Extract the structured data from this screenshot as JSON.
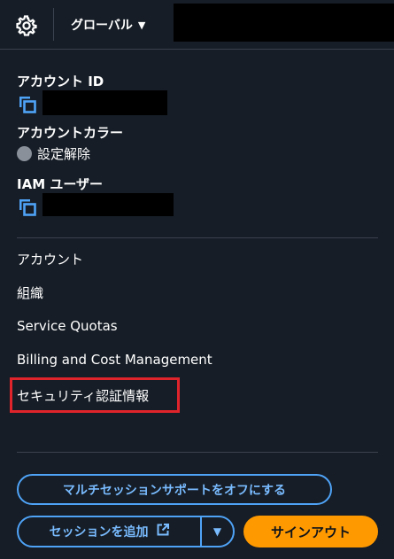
{
  "header": {
    "settings_icon": "gear-icon",
    "region_label": "グローバル",
    "region_caret": "▼"
  },
  "account": {
    "account_id_label": "アカウント ID",
    "account_color_label": "アカウントカラー",
    "account_color_value": "設定解除",
    "iam_user_label": "IAM ユーザー"
  },
  "menu": {
    "items": [
      "アカウント",
      "組織",
      "Service Quotas",
      "Billing and Cost Management",
      "セキュリティ認証情報"
    ]
  },
  "actions": {
    "multi_session_off": "マルチセッションサポートをオフにする",
    "add_session": "セッションを追加",
    "add_session_dropdown": "▼",
    "sign_out": "サインアウト"
  },
  "colors": {
    "background": "#161d26",
    "accent_blue": "#4fa3f7",
    "sign_out_orange": "#ff9900",
    "highlight_red": "#e0242b"
  }
}
